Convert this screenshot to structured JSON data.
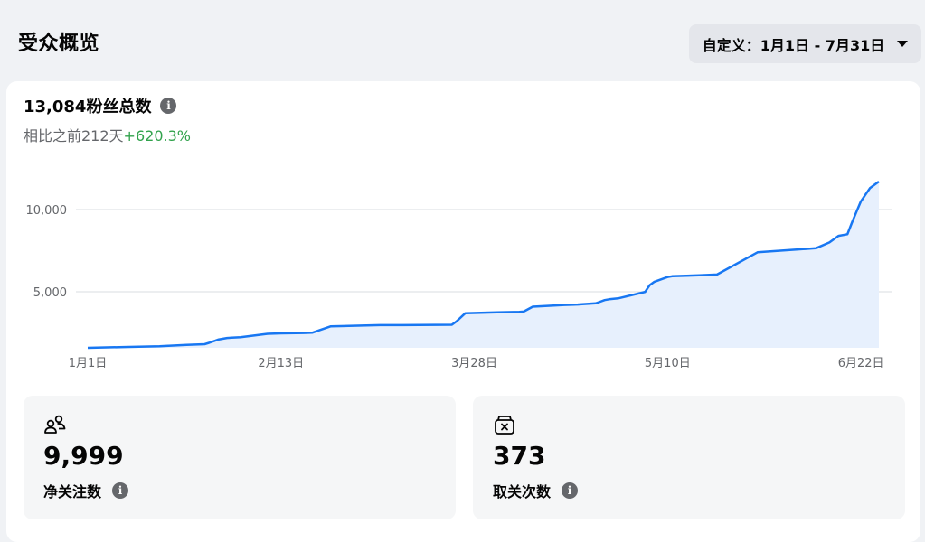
{
  "header": {
    "title": "受众概览",
    "date_range_label": "自定义：1月1日 - 7月31日"
  },
  "summary": {
    "total_text": "13,084粉丝总数",
    "compare_text": "相比之前212天",
    "compare_change": "+620.3%"
  },
  "chart_data": {
    "type": "area",
    "title": "",
    "xlabel": "",
    "ylabel": "",
    "x_ticks": [
      "1月1日",
      "2月13日",
      "3月28日",
      "5月10日",
      "6月22日"
    ],
    "y_ticks": [
      "5,000",
      "10,000"
    ],
    "ylim": [
      0,
      12000
    ],
    "grid": true,
    "series": [
      {
        "color": "#1877f2",
        "fill": "#e7f0fd",
        "x": [
          1,
          9,
          17,
          23,
          27,
          28,
          30,
          32,
          35,
          41,
          44,
          49,
          51,
          55,
          62,
          66,
          71,
          82,
          83,
          85,
          92,
          97,
          98,
          100,
          107,
          110,
          111,
          114,
          115,
          116,
          117,
          119,
          125,
          126,
          127,
          130,
          131,
          137,
          141,
          150,
          163,
          166,
          168,
          170,
          171,
          172,
          173,
          174,
          175,
          177
        ],
        "values": [
          1600,
          1650,
          1700,
          1780,
          1820,
          1900,
          2100,
          2200,
          2250,
          2450,
          2480,
          2500,
          2520,
          2900,
          2950,
          2980,
          2980,
          3000,
          3200,
          3700,
          3750,
          3780,
          3800,
          4100,
          4200,
          4230,
          4250,
          4300,
          4400,
          4500,
          4550,
          4600,
          5000,
          5400,
          5600,
          5900,
          5950,
          6000,
          6050,
          7400,
          7650,
          8000,
          8400,
          8500,
          9200,
          9850,
          10500,
          10900,
          11300,
          11700
        ]
      }
    ]
  },
  "stats": [
    {
      "icon": "people-icon",
      "value": "9,999",
      "label": "净关注数"
    },
    {
      "icon": "unfollow-icon",
      "value": "373",
      "label": "取关次数"
    }
  ]
}
